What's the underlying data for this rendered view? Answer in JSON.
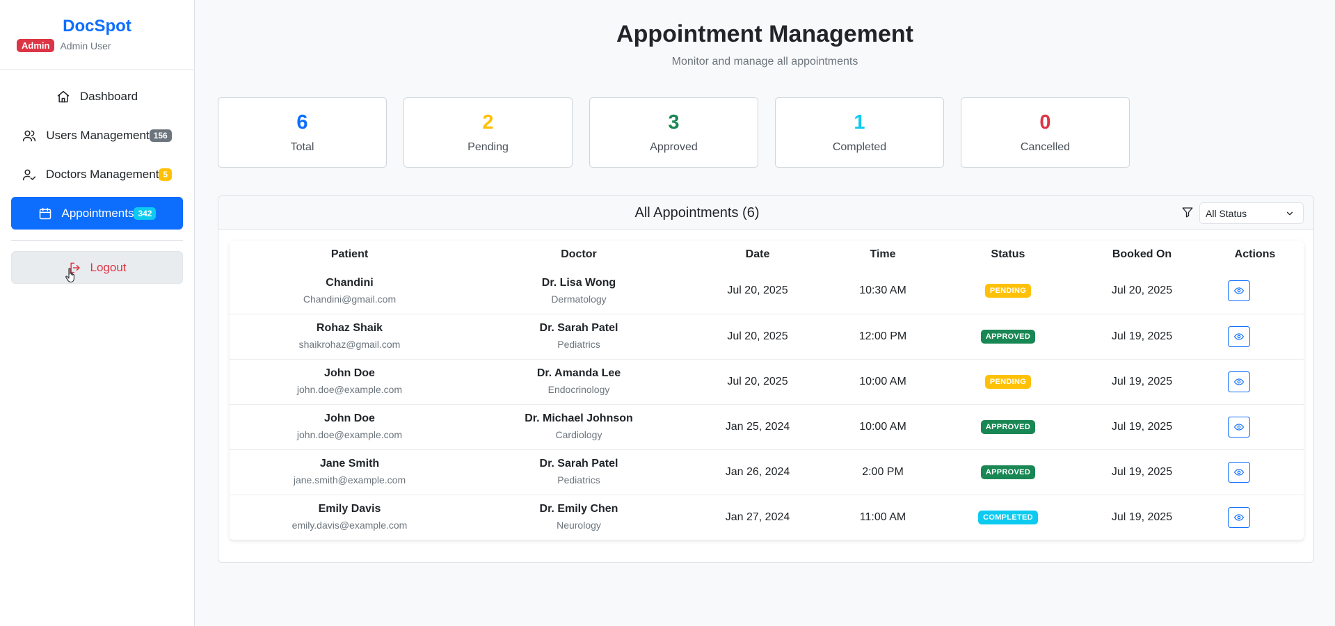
{
  "sidebar": {
    "brand": "DocSpot",
    "role_badge": "Admin",
    "user_name": "Admin User",
    "nav": [
      {
        "label": "Dashboard",
        "icon": "home-icon",
        "count": null
      },
      {
        "label": "Users Management",
        "icon": "users-icon",
        "count": "156",
        "count_color": "#6c757d"
      },
      {
        "label": "Doctors Management",
        "icon": "user-check-icon",
        "count": "5",
        "count_color": "#ffc107"
      },
      {
        "label": "Appointments",
        "icon": "calendar-icon",
        "count": "342",
        "count_color": "#0dcaf0",
        "active": true
      }
    ],
    "logout_label": "Logout"
  },
  "header": {
    "title": "Appointment Management",
    "subtitle": "Monitor and manage all appointments"
  },
  "stats": [
    {
      "value": "6",
      "label": "Total",
      "color": "#0d6efd"
    },
    {
      "value": "2",
      "label": "Pending",
      "color": "#ffc107"
    },
    {
      "value": "3",
      "label": "Approved",
      "color": "#198754"
    },
    {
      "value": "1",
      "label": "Completed",
      "color": "#0dcaf0"
    },
    {
      "value": "0",
      "label": "Cancelled",
      "color": "#dc3545"
    }
  ],
  "appointments_card": {
    "title": "All Appointments (6)",
    "filter_value": "All Status",
    "columns": [
      "Patient",
      "Doctor",
      "Date",
      "Time",
      "Status",
      "Booked On",
      "Actions"
    ],
    "rows": [
      {
        "patient": "Chandini",
        "email": "Chandini@gmail.com",
        "doctor": "Dr. Lisa Wong",
        "specialty": "Dermatology",
        "date": "Jul 20, 2025",
        "time": "10:30 AM",
        "status": "PENDING",
        "booked": "Jul 20, 2025"
      },
      {
        "patient": "Rohaz Shaik",
        "email": "shaikrohaz@gmail.com",
        "doctor": "Dr. Sarah Patel",
        "specialty": "Pediatrics",
        "date": "Jul 20, 2025",
        "time": "12:00 PM",
        "status": "APPROVED",
        "booked": "Jul 19, 2025"
      },
      {
        "patient": "John Doe",
        "email": "john.doe@example.com",
        "doctor": "Dr. Amanda Lee",
        "specialty": "Endocrinology",
        "date": "Jul 20, 2025",
        "time": "10:00 AM",
        "status": "PENDING",
        "booked": "Jul 19, 2025"
      },
      {
        "patient": "John Doe",
        "email": "john.doe@example.com",
        "doctor": "Dr. Michael Johnson",
        "specialty": "Cardiology",
        "date": "Jan 25, 2024",
        "time": "10:00 AM",
        "status": "APPROVED",
        "booked": "Jul 19, 2025"
      },
      {
        "patient": "Jane Smith",
        "email": "jane.smith@example.com",
        "doctor": "Dr. Sarah Patel",
        "specialty": "Pediatrics",
        "date": "Jan 26, 2024",
        "time": "2:00 PM",
        "status": "APPROVED",
        "booked": "Jul 19, 2025"
      },
      {
        "patient": "Emily Davis",
        "email": "emily.davis@example.com",
        "doctor": "Dr. Emily Chen",
        "specialty": "Neurology",
        "date": "Jan 27, 2024",
        "time": "11:00 AM",
        "status": "COMPLETED",
        "booked": "Jul 19, 2025"
      }
    ]
  }
}
